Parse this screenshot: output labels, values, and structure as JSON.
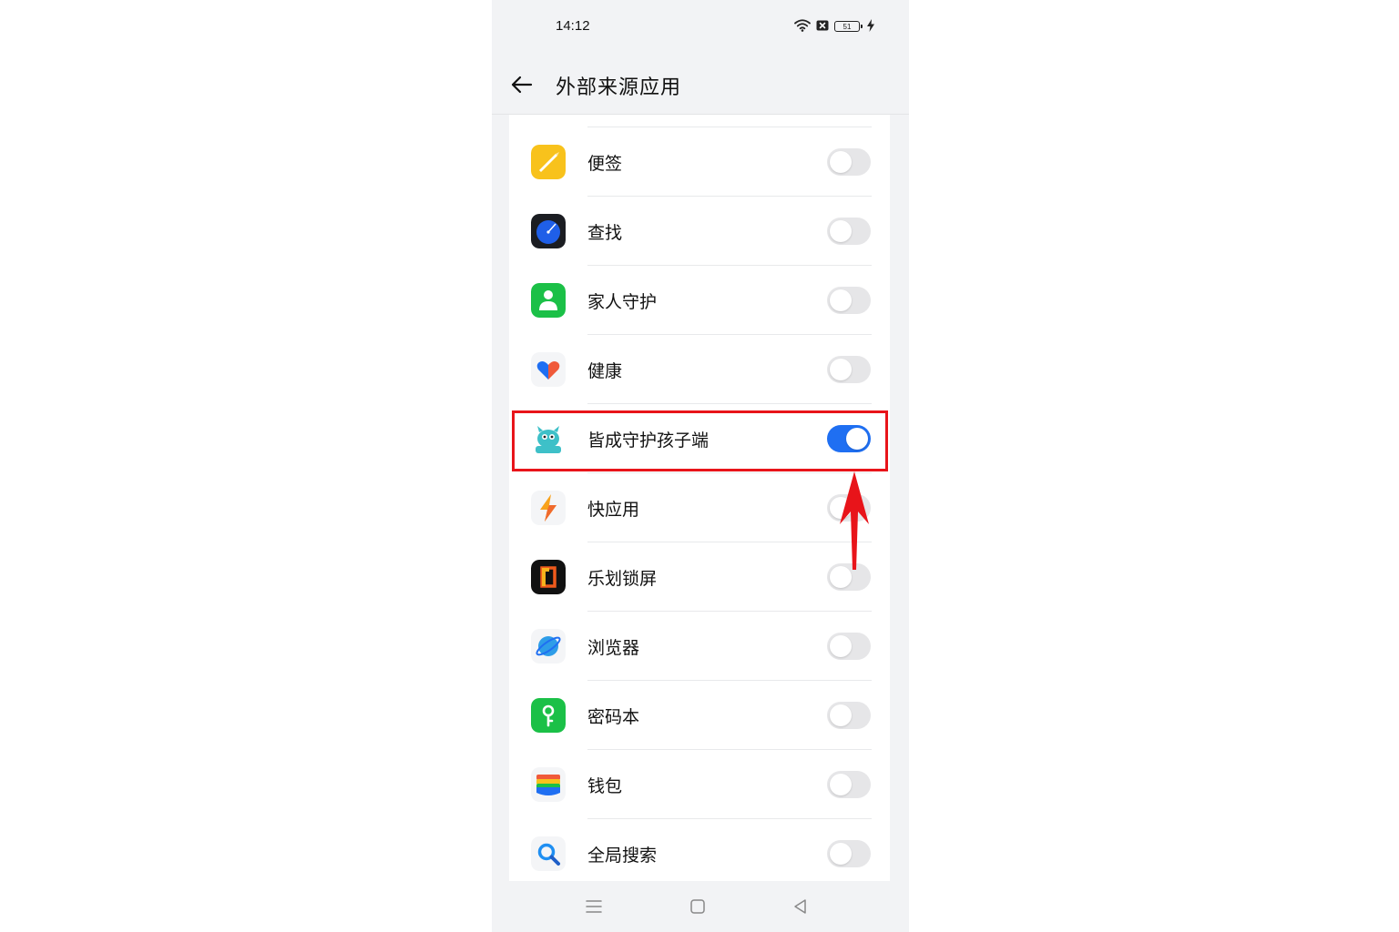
{
  "status_bar": {
    "time": "14:12",
    "battery_level": "51"
  },
  "header": {
    "title": "外部来源应用"
  },
  "apps": [
    {
      "name": "便签",
      "enabled": false,
      "icon": "notes-icon"
    },
    {
      "name": "查找",
      "enabled": false,
      "icon": "find-icon"
    },
    {
      "name": "家人守护",
      "enabled": false,
      "icon": "family-guard-icon"
    },
    {
      "name": "健康",
      "enabled": false,
      "icon": "health-heart-icon"
    },
    {
      "name": "皆成守护孩子端",
      "enabled": true,
      "icon": "kids-monster-icon"
    },
    {
      "name": "快应用",
      "enabled": false,
      "icon": "quick-app-lightning-icon"
    },
    {
      "name": "乐划锁屏",
      "enabled": false,
      "icon": "lock-screen-icon"
    },
    {
      "name": "浏览器",
      "enabled": false,
      "icon": "browser-planet-icon"
    },
    {
      "name": "密码本",
      "enabled": false,
      "icon": "password-key-icon"
    },
    {
      "name": "钱包",
      "enabled": false,
      "icon": "wallet-icon"
    },
    {
      "name": "全局搜索",
      "enabled": false,
      "icon": "search-icon"
    }
  ],
  "colors": {
    "toggle_on": "#1f6ff2",
    "toggle_off": "#e6e6e8",
    "highlight": "#e8141a"
  }
}
